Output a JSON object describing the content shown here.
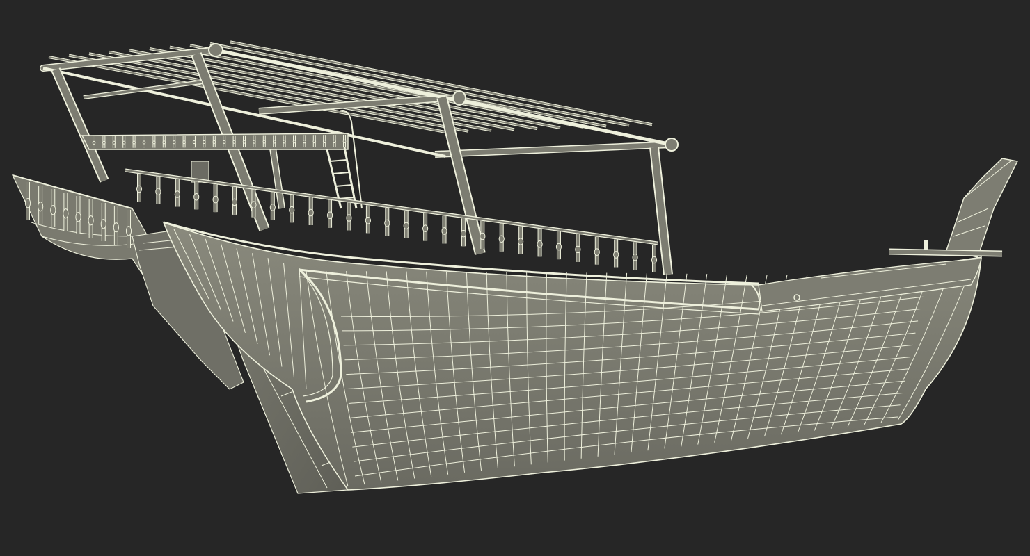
{
  "scene": {
    "background_color": "#262626",
    "model_fill_color": "#7f7f73",
    "model_shade_color": "#6e6e64",
    "model_dark_color": "#5d5d55",
    "wire_color": "#eef0dc",
    "render_style": "shaded-wireframe",
    "subject_icon": "dhow-boat-3d-model-icon"
  }
}
